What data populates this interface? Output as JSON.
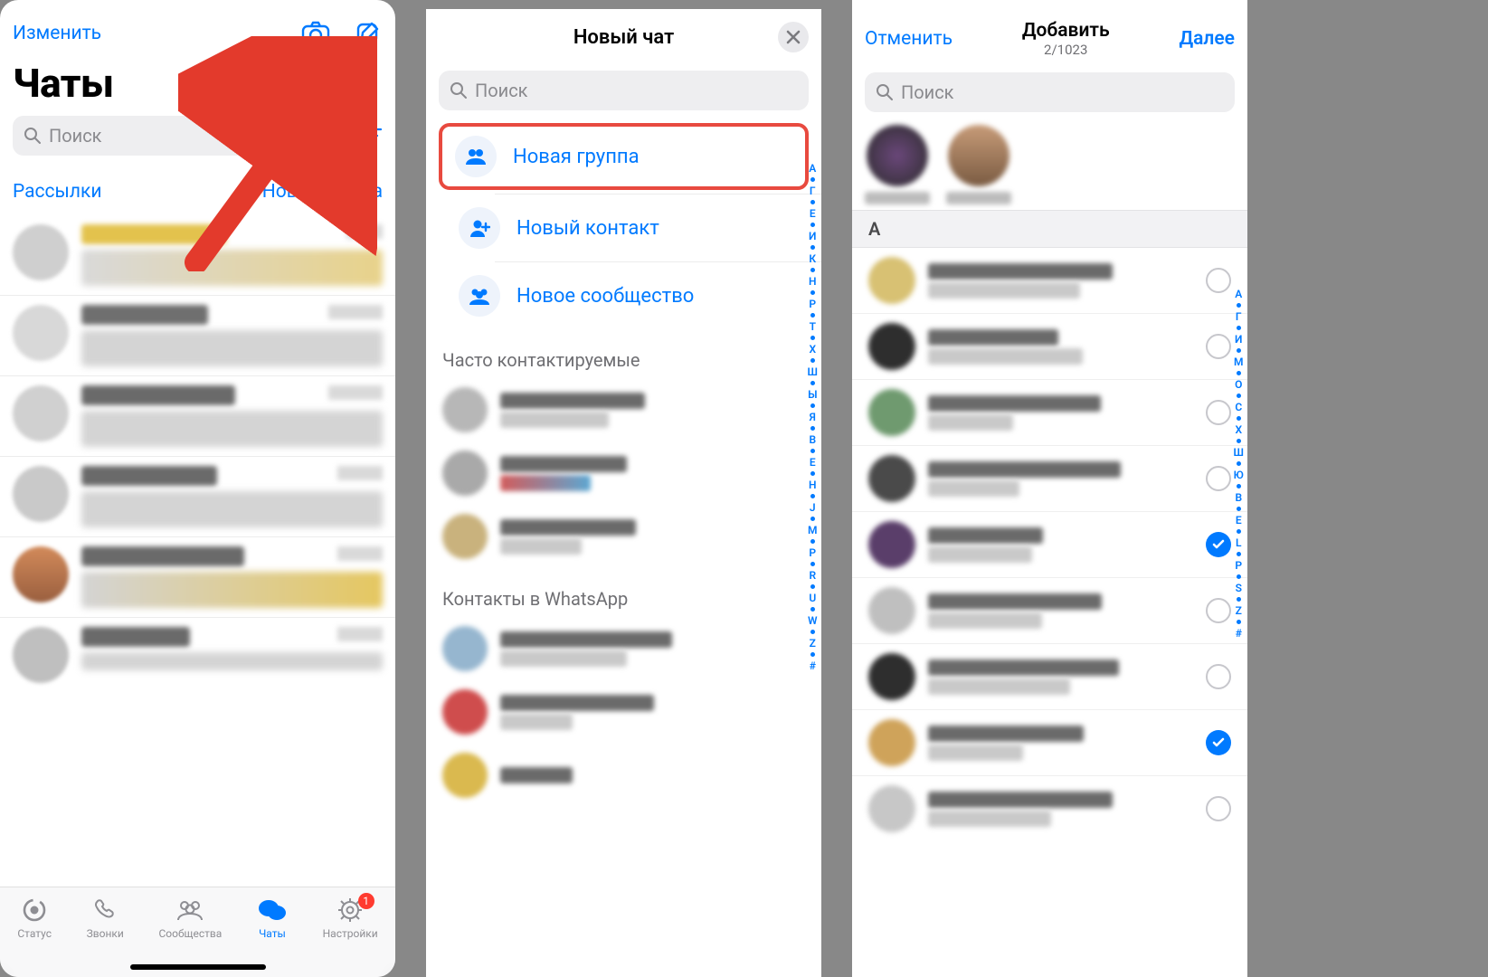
{
  "screen1": {
    "edit": "Изменить",
    "title": "Чаты",
    "search_placeholder": "Поиск",
    "broadcasts": "Рассылки",
    "new_group": "Новая группа",
    "tabs": {
      "status": "Статус",
      "calls": "Звонки",
      "communities": "Сообщества",
      "chats": "Чаты",
      "settings": "Настройки",
      "settings_badge": "1"
    }
  },
  "screen2": {
    "title": "Новый чат",
    "search_placeholder": "Поиск",
    "new_group": "Новая группа",
    "new_contact": "Новый контакт",
    "new_community": "Новое сообщество",
    "frequent_header": "Часто контактируемые",
    "contacts_header": "Контакты в WhatsApp",
    "alpha": [
      "А",
      "●",
      "Г",
      "●",
      "Е",
      "●",
      "И",
      "●",
      "К",
      "●",
      "Н",
      "●",
      "Р",
      "●",
      "Т",
      "●",
      "Х",
      "●",
      "Ш",
      "●",
      "Ы",
      "●",
      "Я",
      "●",
      "B",
      "●",
      "E",
      "●",
      "H",
      "●",
      "J",
      "●",
      "M",
      "●",
      "P",
      "●",
      "R",
      "●",
      "U",
      "●",
      "W",
      "●",
      "Z",
      "●",
      "#"
    ]
  },
  "screen3": {
    "cancel": "Отменить",
    "title": "Добавить",
    "counter": "2/1023",
    "next": "Далее",
    "search_placeholder": "Поиск",
    "section_letter": "A",
    "alpha": [
      "А",
      "●",
      "Г",
      "●",
      "И",
      "●",
      "М",
      "●",
      "О",
      "●",
      "С",
      "●",
      "Х",
      "●",
      "Ш",
      "●",
      "Ю",
      "●",
      "B",
      "●",
      "E",
      "●",
      "L",
      "●",
      "P",
      "●",
      "S",
      "●",
      "Z",
      "●",
      "#"
    ],
    "rows_checked": [
      false,
      false,
      false,
      false,
      true,
      false,
      false,
      true,
      false
    ]
  }
}
